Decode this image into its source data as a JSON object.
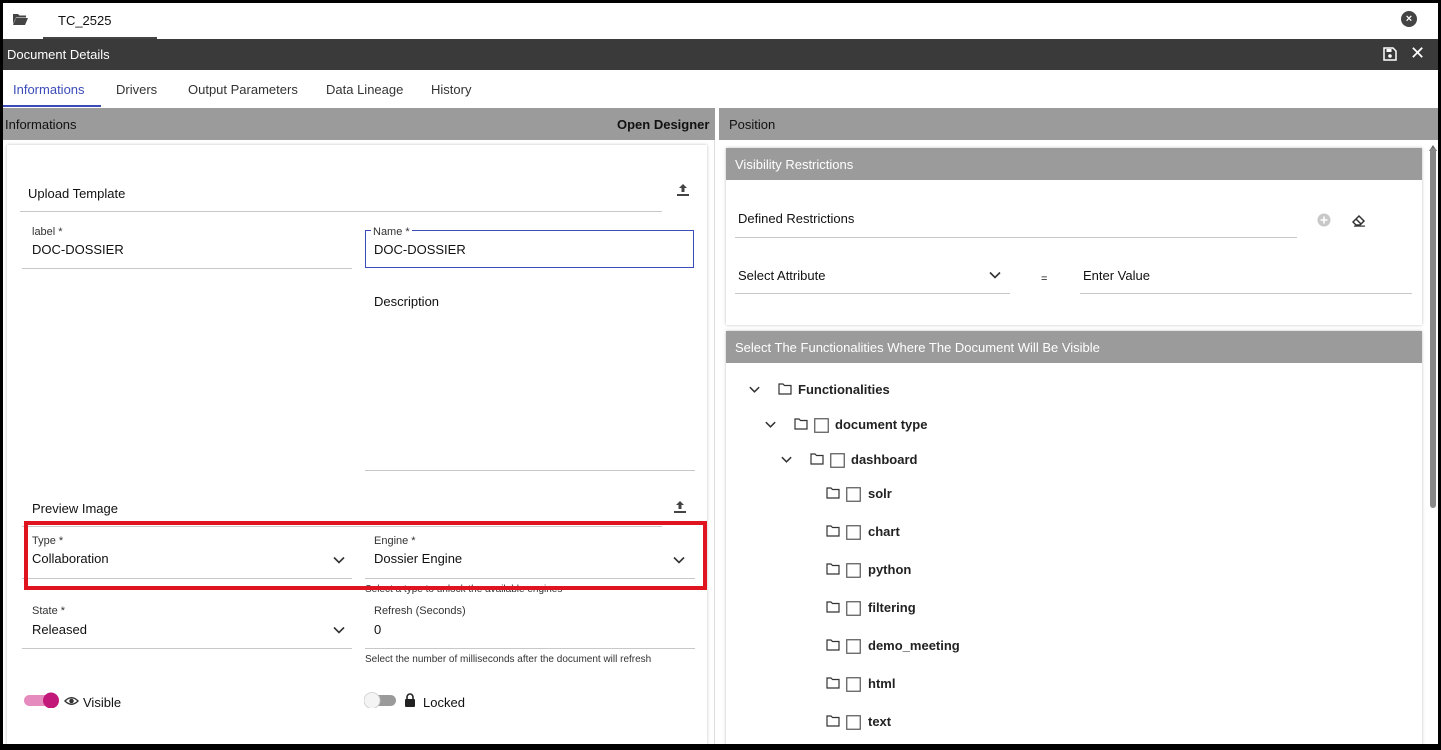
{
  "top_tab": {
    "label": "TC_2525"
  },
  "doc_bar": {
    "title": "Document Details"
  },
  "tabs": [
    {
      "label": "Informations"
    },
    {
      "label": "Drivers"
    },
    {
      "label": "Output Parameters"
    },
    {
      "label": "Data Lineage"
    },
    {
      "label": "History"
    }
  ],
  "left_header": {
    "title": "Informations",
    "action": "Open Designer"
  },
  "right_header": {
    "title": "Position"
  },
  "form": {
    "upload_template": "Upload Template",
    "label_field": {
      "label": "label *",
      "value": "DOC-DOSSIER"
    },
    "name_field": {
      "label": "Name *",
      "value": "DOC-DOSSIER"
    },
    "description_label": "Description",
    "preview_image": "Preview Image",
    "type_field": {
      "label": "Type *",
      "value": "Collaboration"
    },
    "engine_field": {
      "label": "Engine *",
      "value": "Dossier Engine",
      "hint": "Select a type to unlock the available engines"
    },
    "state_field": {
      "label": "State *",
      "value": "Released"
    },
    "refresh_field": {
      "label": "Refresh (Seconds)",
      "value": "0",
      "hint": "Select the number of milliseconds after the document will refresh"
    },
    "visible_toggle": {
      "label": "Visible",
      "on": true
    },
    "locked_toggle": {
      "label": "Locked",
      "on": false
    }
  },
  "visibility": {
    "title": "Visibility Restrictions",
    "defined_label": "Defined Restrictions",
    "select_attribute": "Select Attribute",
    "equals": "=",
    "enter_value_placeholder": "Enter Value"
  },
  "functionalities": {
    "title": "Select The Functionalities Where The Document Will Be Visible",
    "root": "Functionalities",
    "document_type": "document type",
    "dashboard": "dashboard",
    "children": [
      "solr",
      "chart",
      "python",
      "filtering",
      "demo_meeting",
      "html",
      "text"
    ]
  },
  "colors": {
    "accent": "#3b4cb8",
    "toggle_on": "#c2187a",
    "highlight": "#e0141e",
    "section_gray": "#9b9b9b",
    "dark_bar": "#3a3a3a"
  }
}
